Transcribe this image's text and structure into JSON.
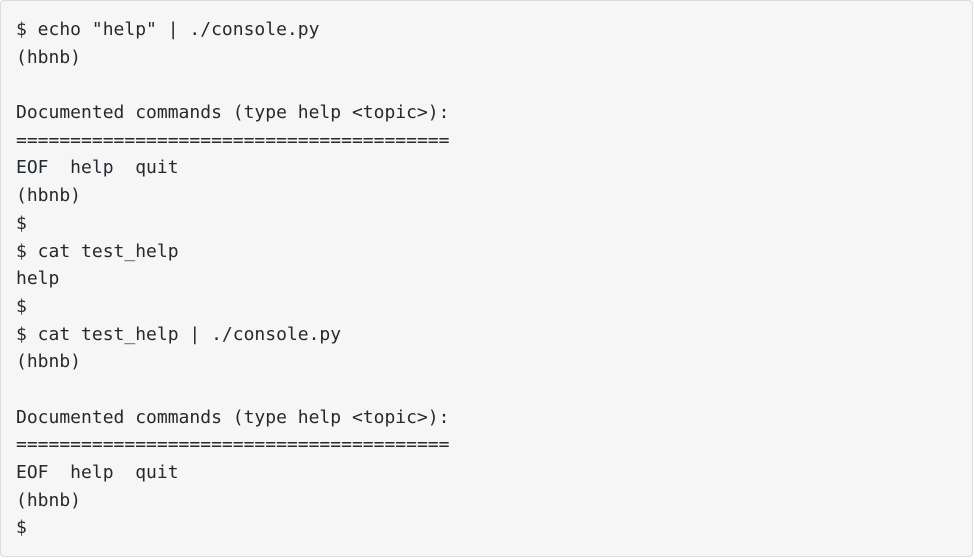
{
  "terminal": {
    "lines": [
      "$ echo \"help\" | ./console.py",
      "(hbnb)",
      "",
      "Documented commands (type help <topic>):",
      "========================================",
      "EOF  help  quit",
      "(hbnb)",
      "$",
      "$ cat test_help",
      "help",
      "$",
      "$ cat test_help | ./console.py",
      "(hbnb)",
      "",
      "Documented commands (type help <topic>):",
      "========================================",
      "EOF  help  quit",
      "(hbnb)",
      "$"
    ]
  }
}
